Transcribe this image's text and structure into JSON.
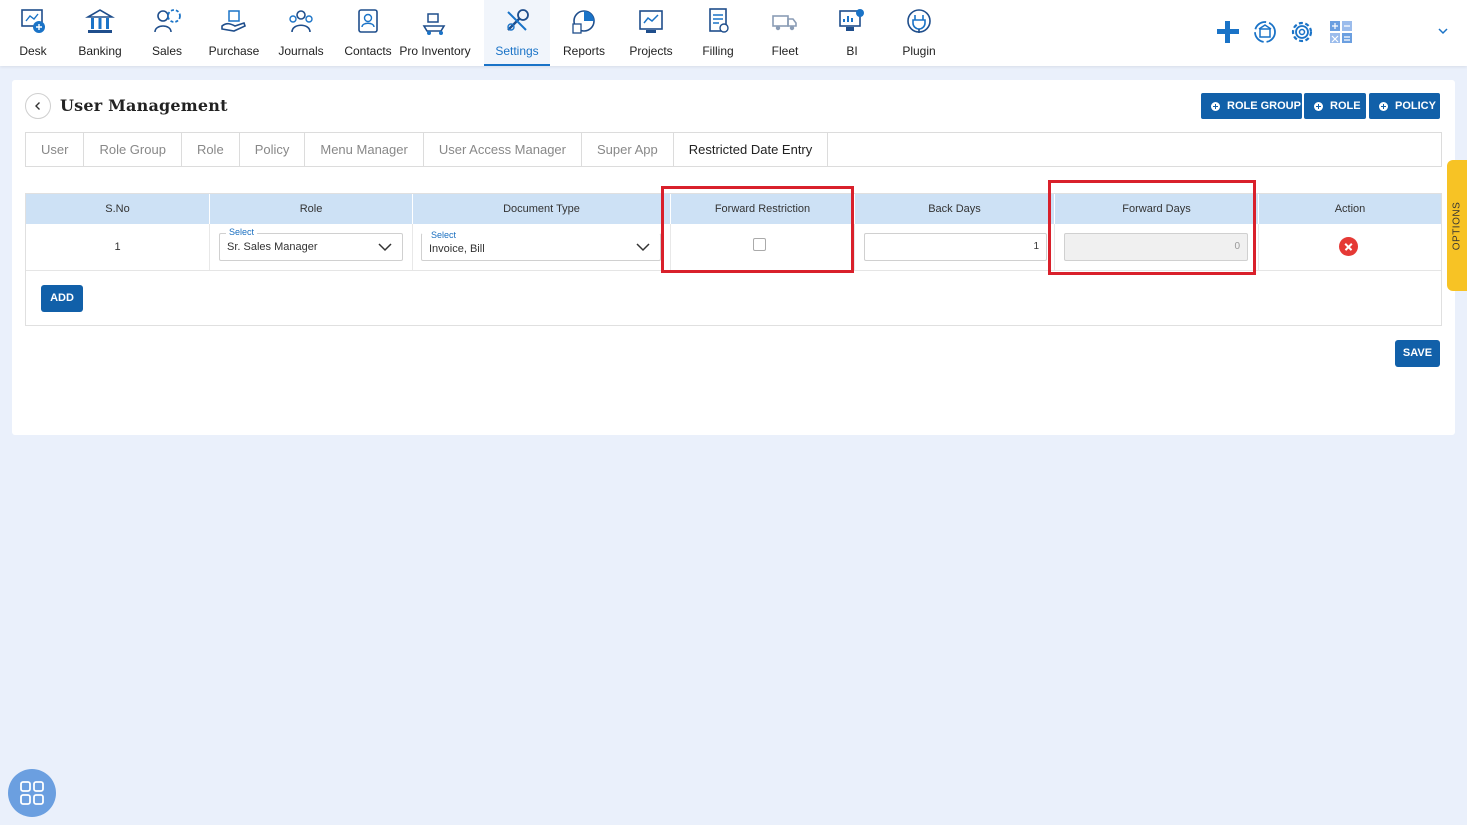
{
  "nav": {
    "items": [
      {
        "label": "Desk",
        "icon": "desk-icon"
      },
      {
        "label": "Banking",
        "icon": "bank-icon"
      },
      {
        "label": "Sales",
        "icon": "sales-icon"
      },
      {
        "label": "Purchase",
        "icon": "purchase-icon"
      },
      {
        "label": "Journals",
        "icon": "journals-icon"
      },
      {
        "label": "Contacts",
        "icon": "contacts-icon"
      },
      {
        "label": "Pro Inventory",
        "icon": "inventory-icon"
      },
      {
        "label": "Settings",
        "icon": "settings-icon"
      },
      {
        "label": "Reports",
        "icon": "reports-icon"
      },
      {
        "label": "Projects",
        "icon": "projects-icon"
      },
      {
        "label": "Filling",
        "icon": "filling-icon"
      },
      {
        "label": "Fleet",
        "icon": "fleet-icon"
      },
      {
        "label": "BI",
        "icon": "bi-icon"
      },
      {
        "label": "Plugin",
        "icon": "plugin-icon"
      }
    ],
    "active": "Settings"
  },
  "page": {
    "title": "User Management",
    "buttons": {
      "role_group": "ROLE GROUP",
      "role": "ROLE",
      "policy": "POLICY"
    }
  },
  "tabs": [
    "User",
    "Role Group",
    "Role",
    "Policy",
    "Menu Manager",
    "User Access Manager",
    "Super App",
    "Restricted Date Entry"
  ],
  "active_tab": "Restricted Date Entry",
  "grid": {
    "headers": {
      "sno": "S.No",
      "role": "Role",
      "document_type": "Document Type",
      "forward_restriction": "Forward Restriction",
      "back_days": "Back Days",
      "forward_days": "Forward Days",
      "action": "Action"
    },
    "rows": [
      {
        "sno": "1",
        "role_label": "Select",
        "role_value": "Sr. Sales Manager",
        "doc_label": "Select",
        "doc_value": "Invoice, Bill",
        "forward_restriction": false,
        "back_days": "1",
        "forward_days": "0"
      }
    ]
  },
  "add_label": "ADD",
  "save_label": "SAVE",
  "options_label": "OPTIONS",
  "colors": {
    "primary": "#1160a9",
    "header_bg": "#cde1f5",
    "highlight": "#d9202b",
    "options": "#f7c325"
  }
}
